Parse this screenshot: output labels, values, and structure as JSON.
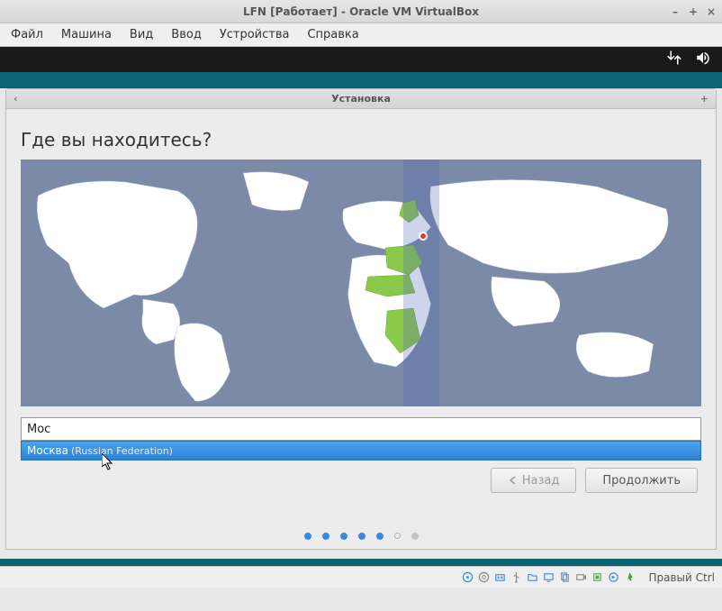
{
  "window": {
    "title": "LFN [Работает] - Oracle VM VirtualBox",
    "minimize": "–",
    "maximize": "+",
    "close": "×"
  },
  "menubar": {
    "items": [
      "Файл",
      "Машина",
      "Вид",
      "Ввод",
      "Устройства",
      "Справка"
    ]
  },
  "installer": {
    "header_title": "Установка",
    "heading": "Где вы находитесь?",
    "location_input_value": "Мос",
    "suggestion_city": "Москва",
    "suggestion_country": "(Russian Federation)",
    "back_label": "Назад",
    "continue_label": "Продолжить"
  },
  "progress": {
    "total": 7,
    "active_until": 5
  },
  "statusbar": {
    "hostkey": "Правый Ctrl",
    "icons": [
      "disc-icon",
      "optical-icon",
      "network-icon",
      "usb-icon",
      "folder-icon",
      "display-icon",
      "clipboard-icon",
      "record-icon",
      "cpu-icon",
      "vm-icon",
      "power-icon"
    ]
  }
}
